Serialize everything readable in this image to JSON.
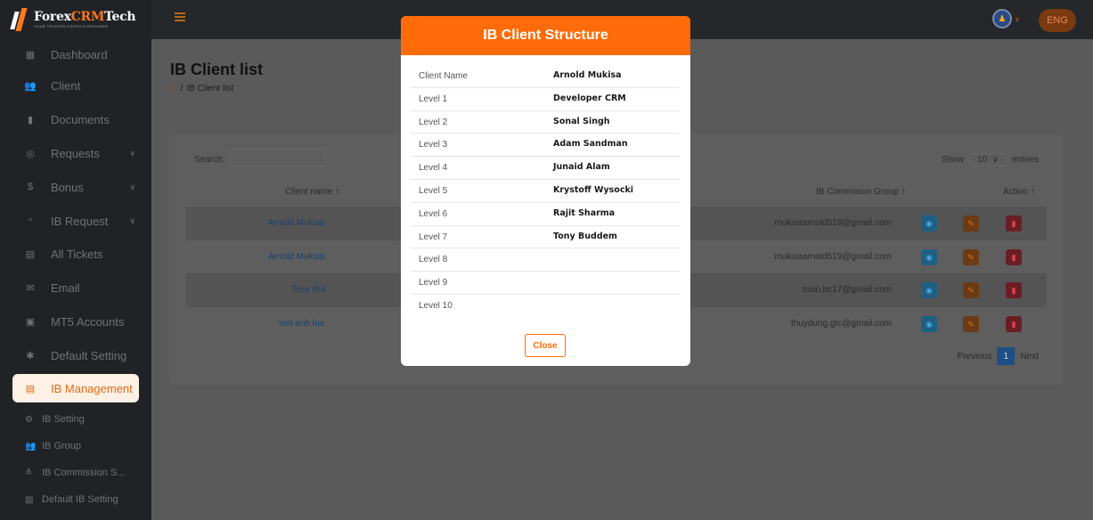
{
  "brand": {
    "name_main": "Forex",
    "name_crm": "CRM",
    "name_tail": "Tech",
    "tagline": "YOUR TRUSTED FINTECH PROVIDER"
  },
  "sidebar": {
    "items": [
      {
        "label": "Dashboard",
        "icon": "dashboard-icon"
      },
      {
        "label": "Client",
        "icon": "users-icon"
      },
      {
        "label": "Documents",
        "icon": "documents-icon"
      },
      {
        "label": "Requests",
        "icon": "requests-icon"
      },
      {
        "label": "Bonus",
        "icon": "bonus-icon"
      },
      {
        "label": "IB Request",
        "icon": "user-plus-icon"
      },
      {
        "label": "All Tickets",
        "icon": "tickets-icon"
      },
      {
        "label": "Email",
        "icon": "email-icon"
      },
      {
        "label": "MT5 Accounts",
        "icon": "id-card-icon"
      },
      {
        "label": "Default Setting",
        "icon": "gear-icon"
      },
      {
        "label": "IB Management",
        "icon": "ib-management-icon"
      }
    ],
    "sub_items": [
      {
        "label": "IB Setting",
        "icon": "user-cog-icon"
      },
      {
        "label": "IB Group",
        "icon": "group-icon"
      },
      {
        "label": "IB Commission S...",
        "icon": "commission-icon"
      },
      {
        "label": "Default IB Setting",
        "icon": "message-icon"
      }
    ]
  },
  "topbar": {
    "lang": "ENG"
  },
  "page": {
    "title": "IB Client list",
    "breadcrumb": "IB Client list"
  },
  "table": {
    "search_label": "Search:",
    "show_label": "Show",
    "show_value": "10",
    "entries_label": "entries",
    "headers": {
      "client_name": "Client name",
      "commission_group": "IB Commision Group",
      "action": "Action"
    },
    "rows": [
      {
        "name": "Arnold Mukisa",
        "email": "mukisaarnold519@gmail.com"
      },
      {
        "name": "Arnold Mukisa",
        "email": "mukisaarnold519@gmail.com"
      },
      {
        "name": "Tony Bui",
        "email": "toan.bc17@gmail.com"
      },
      {
        "name": "viet anh bui",
        "email": "thuydung.gtc@gmail.com"
      }
    ],
    "pager": {
      "previous": "Previous",
      "page": "1",
      "next": "Next"
    }
  },
  "modal": {
    "title": "IB Client Structure",
    "rows": [
      {
        "label": "Client Name",
        "value": "Arnold Mukisa"
      },
      {
        "label": "Level 1",
        "value": "Developer CRM"
      },
      {
        "label": "Level 2",
        "value": "Sonal Singh"
      },
      {
        "label": "Level 3",
        "value": "Adam Sandman"
      },
      {
        "label": "Level 4",
        "value": "Junaid Alam"
      },
      {
        "label": "Level 5",
        "value": "Krystoff Wysocki"
      },
      {
        "label": "Level 6",
        "value": "Rajit Sharma"
      },
      {
        "label": "Level 7",
        "value": "Tony Buddem"
      },
      {
        "label": "Level 8",
        "value": ""
      },
      {
        "label": "Level 9",
        "value": ""
      },
      {
        "label": "Level 10",
        "value": ""
      }
    ],
    "close_label": "Close"
  },
  "colors": {
    "accent": "#ff6b08",
    "sidebar_bg": "#202226",
    "link": "#1a3f6e"
  }
}
